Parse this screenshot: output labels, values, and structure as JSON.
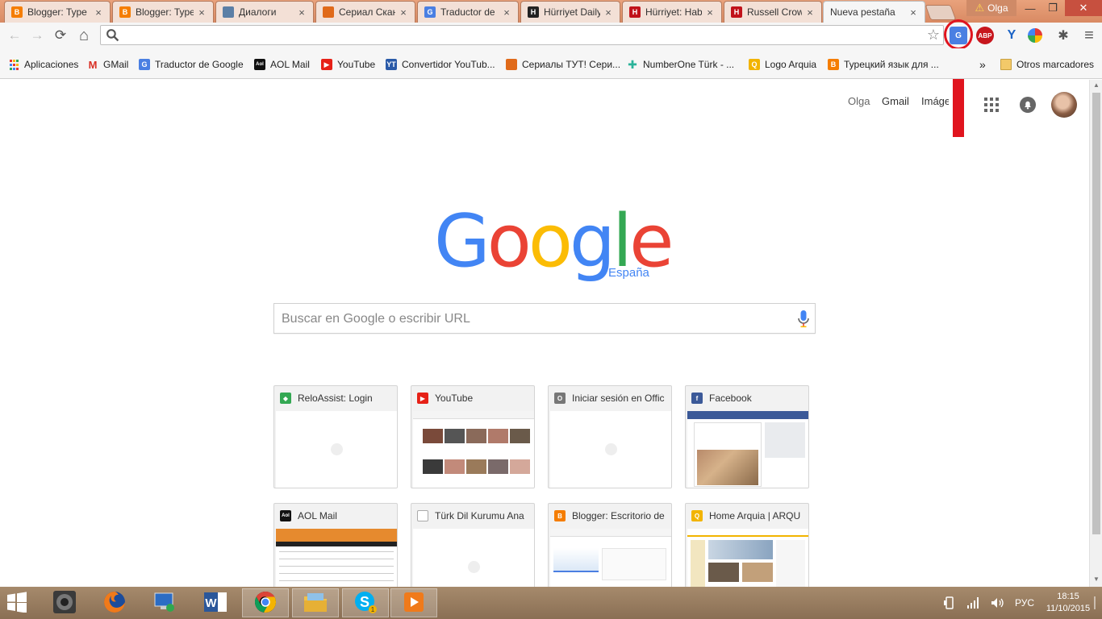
{
  "browser": {
    "tabs": [
      {
        "title": "Blogger: Type",
        "icon": "blogger-icon",
        "color": "#f57d00",
        "glyph": "B"
      },
      {
        "title": "Blogger: Type",
        "icon": "blogger-icon",
        "color": "#f57d00",
        "glyph": "B"
      },
      {
        "title": "Диалоги",
        "icon": "chat-icon",
        "color": "#5b7fa6",
        "glyph": ""
      },
      {
        "title": "Сериал Скан",
        "icon": "fox-icon",
        "color": "#e06a1a",
        "glyph": ""
      },
      {
        "title": "Traductor de",
        "icon": "google-translate-icon",
        "color": "#4a7fe2",
        "glyph": "G"
      },
      {
        "title": "Hürriyet Daily",
        "icon": "hurriyet-icon",
        "color": "#222222",
        "glyph": "H"
      },
      {
        "title": "Hürriyet: Hab",
        "icon": "hurriyet-icon",
        "color": "#c1121a",
        "glyph": "H"
      },
      {
        "title": "Russell Crowe",
        "icon": "hurriyet-icon",
        "color": "#c1121a",
        "glyph": "H"
      },
      {
        "title": "Nueva pestaña",
        "icon": "",
        "color": "",
        "glyph": "",
        "active": true
      }
    ],
    "close_glyph": "×",
    "profile_name": "Olga",
    "window_controls": {
      "minimize": "—",
      "restore": "❐",
      "close": "✕"
    }
  },
  "toolbar": {
    "back": "←",
    "forward": "→",
    "reload": "⟳",
    "home": "⌂",
    "address_value": "",
    "star": "☆",
    "extensions": [
      {
        "name": "google-translate-extension-icon",
        "label": "G",
        "color": "#4a7fe2"
      },
      {
        "name": "adblock-plus-icon",
        "label": "ABP",
        "color": "#c7161d"
      },
      {
        "name": "y-extension-icon",
        "label": "Y",
        "color": "#1a63c6"
      },
      {
        "name": "color-wheel-extension-icon",
        "label": "",
        "color": "#e53935"
      },
      {
        "name": "bug-extension-icon",
        "label": "",
        "color": "#555555"
      }
    ],
    "menu": "≡"
  },
  "bookmarks": {
    "items": [
      {
        "label": "Aplicaciones",
        "icon": "apps-grid-icon",
        "color": "#555555",
        "glyph": "⋮"
      },
      {
        "label": "GMail",
        "icon": "gmail-icon",
        "color": "#d93025",
        "glyph": "M"
      },
      {
        "label": "Traductor de Google",
        "icon": "google-translate-icon",
        "color": "#4a7fe2",
        "glyph": "G"
      },
      {
        "label": "AOL Mail",
        "icon": "aol-icon",
        "color": "#111111",
        "glyph": "Aol"
      },
      {
        "label": "YouTube",
        "icon": "youtube-icon",
        "color": "#e62117",
        "glyph": "▶"
      },
      {
        "label": "Convertidor YouTub...",
        "icon": "yt-mp3-icon",
        "color": "#2a5aa8",
        "glyph": "YT"
      },
      {
        "label": "Сериалы ТУТ! Сери...",
        "icon": "fox-icon",
        "color": "#e06a1a",
        "glyph": ""
      },
      {
        "label": "NumberOne Türk - ...",
        "icon": "cross-icon",
        "color": "#2bb39a",
        "glyph": "✚"
      },
      {
        "label": "Logo Arquia",
        "icon": "arquia-icon",
        "color": "#f2b400",
        "glyph": "Q"
      },
      {
        "label": "Турецкий язык для ...",
        "icon": "blogger-icon",
        "color": "#f57d00",
        "glyph": "B"
      }
    ],
    "overflow": "»",
    "other_folder": "Otros marcadores"
  },
  "page": {
    "top_links": {
      "user": "Olga",
      "gmail": "Gmail",
      "images": "Imáge"
    },
    "logo_region": "España",
    "search_placeholder": "Buscar en Google o escribir URL",
    "tiles": [
      {
        "title": "ReloAssist: Login",
        "icon": "reloassist-icon",
        "color": "#34a853",
        "glyph": "◆",
        "thumb": "blank"
      },
      {
        "title": "YouTube",
        "icon": "youtube-icon",
        "color": "#e62117",
        "glyph": "▶",
        "thumb": "youtube"
      },
      {
        "title": "Iniciar sesión en Offic",
        "icon": "office-icon",
        "color": "#777777",
        "glyph": "O",
        "thumb": "blank"
      },
      {
        "title": "Facebook",
        "icon": "facebook-icon",
        "color": "#3b5998",
        "glyph": "f",
        "thumb": "facebook"
      },
      {
        "title": "AOL Mail",
        "icon": "aol-icon",
        "color": "#111111",
        "glyph": "Aol",
        "thumb": "aol"
      },
      {
        "title": "Türk Dil Kurumu Ana",
        "icon": "page-icon",
        "color": "#bbbbbb",
        "glyph": "",
        "thumb": "blank"
      },
      {
        "title": "Blogger: Escritorio de",
        "icon": "blogger-icon",
        "color": "#f57d00",
        "glyph": "B",
        "thumb": "blogger"
      },
      {
        "title": "Home Arquia | ARQU",
        "icon": "arquia-icon",
        "color": "#f2b400",
        "glyph": "Q",
        "thumb": "arquia"
      }
    ]
  },
  "taskbar": {
    "apps": [
      {
        "name": "start-button",
        "icon": "windows-logo-icon"
      },
      {
        "name": "taskbar-audio",
        "icon": "speaker-app-icon"
      },
      {
        "name": "taskbar-firefox",
        "icon": "firefox-icon"
      },
      {
        "name": "taskbar-network",
        "icon": "computer-network-icon"
      },
      {
        "name": "taskbar-word",
        "icon": "word-icon"
      },
      {
        "name": "taskbar-chrome",
        "icon": "chrome-icon",
        "active": true
      },
      {
        "name": "taskbar-explorer",
        "icon": "file-explorer-icon"
      },
      {
        "name": "taskbar-skype",
        "icon": "skype-icon"
      },
      {
        "name": "taskbar-media",
        "icon": "media-player-icon"
      }
    ],
    "language": "РУС",
    "time": "18:15",
    "date": "11/10/2015"
  },
  "annotation": {
    "color": "#e0141e"
  }
}
